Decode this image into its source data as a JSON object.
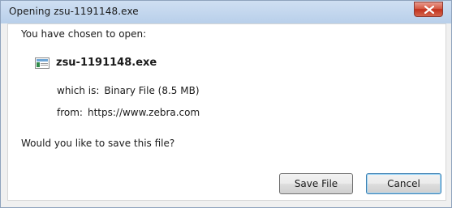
{
  "window": {
    "title": "Opening zsu-1191148.exe"
  },
  "dialog": {
    "intro_label": "You have chosen to open:",
    "file_name": "zsu-1191148.exe",
    "file_icon": "generic-file-icon",
    "which_is_label": "which is:",
    "which_is_value": "Binary File (8.5 MB)",
    "from_label": "from:",
    "from_value": "https://www.zebra.com",
    "question": "Would you like to save this file?"
  },
  "buttons": {
    "save_label": "Save File",
    "cancel_label": "Cancel"
  },
  "colors": {
    "titlebar": "#b8cfea",
    "close_button": "#c2311d",
    "default_button_border": "#3c7fb1"
  }
}
